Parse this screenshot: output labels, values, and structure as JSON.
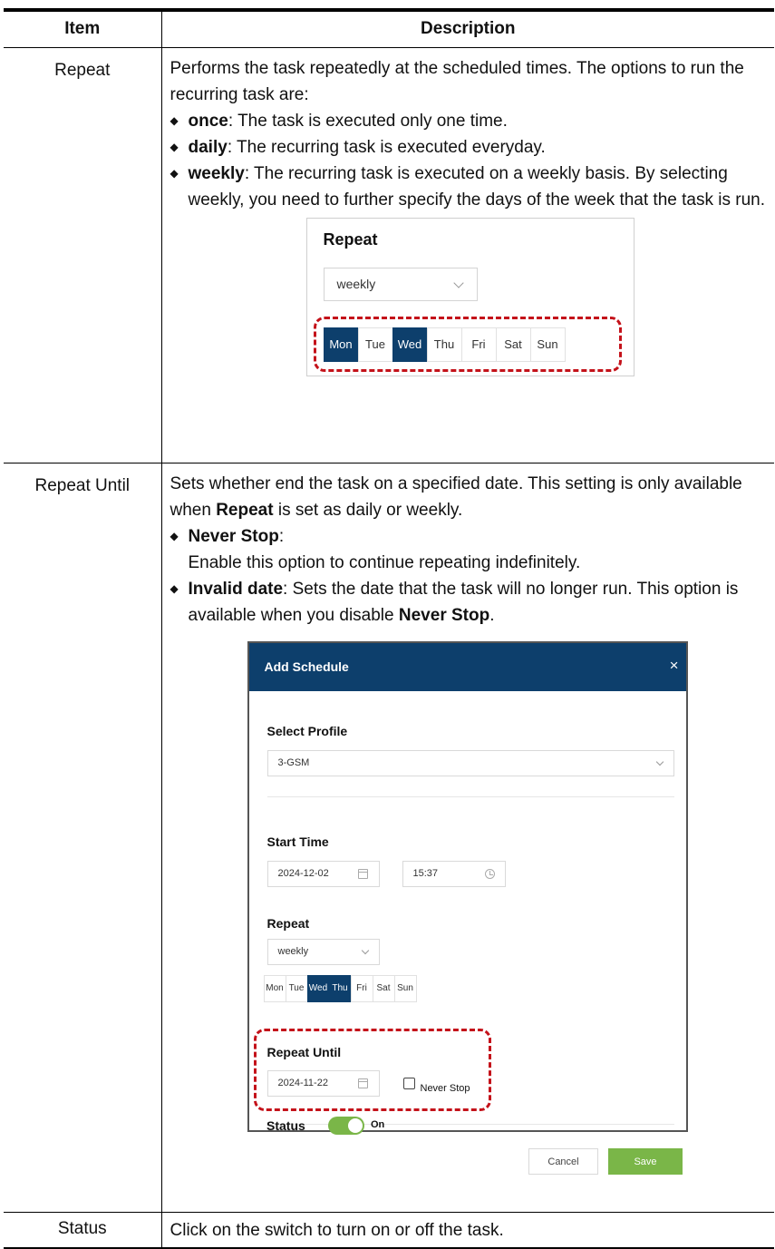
{
  "table": {
    "header": {
      "item": "Item",
      "description": "Description"
    },
    "rows": [
      {
        "item": "Repeat",
        "intro": "Performs the task repeatedly at the scheduled times. The options to run the recurring task are:",
        "bullets": [
          {
            "term": "once",
            "text": ": The task is executed only one time."
          },
          {
            "term": "daily",
            "text": ": The recurring task is executed everyday."
          },
          {
            "term": "weekly",
            "text": ": The recurring task is executed on a weekly basis. By selecting weekly, you need to further specify the days of the week that the task is run."
          }
        ]
      },
      {
        "item": "Repeat Until",
        "intro_a": "Sets whether end the task on a specified date. This setting is only available when ",
        "intro_bold": "Repeat",
        "intro_b": " is set as daily or weekly.",
        "bullet1_term": "Never Stop",
        "bullet1_colon": ":",
        "bullet1_text": "Enable this option to continue repeating indefinitely.",
        "bullet2_term": "Invalid date",
        "bullet2_text": ": Sets the date that the task will no longer run. This option is available when you disable ",
        "bullet2_bold": "Never Stop",
        "bullet2_end": "."
      },
      {
        "item": "Status",
        "text": "Click on the switch to turn on or off the task."
      }
    ]
  },
  "repeat_panel": {
    "title": "Repeat",
    "select_value": "weekly",
    "days": [
      "Mon",
      "Tue",
      "Wed",
      "Thu",
      "Fri",
      "Sat",
      "Sun"
    ],
    "selected_days": [
      "Mon",
      "Wed"
    ]
  },
  "dialog": {
    "title": "Add Schedule",
    "close_glyph": "×",
    "select_profile_label": "Select Profile",
    "profile_value": "3-GSM",
    "start_time_label": "Start Time",
    "start_date": "2024-12-02",
    "start_clock": "15:37",
    "repeat_label": "Repeat",
    "repeat_value": "weekly",
    "days": [
      "Mon",
      "Tue",
      "Wed",
      "Thu",
      "Fri",
      "Sat",
      "Sun"
    ],
    "selected_days": [
      "Wed",
      "Thu"
    ],
    "repeat_until_label": "Repeat Until",
    "until_date": "2024-11-22",
    "never_stop_label": "Never Stop",
    "status_label": "Status",
    "status_value": "On",
    "cancel_label": "Cancel",
    "save_label": "Save"
  },
  "colors": {
    "accent_navy": "#0d3f6c",
    "accent_green": "#7ab648",
    "highlight_red": "#c4121a"
  }
}
